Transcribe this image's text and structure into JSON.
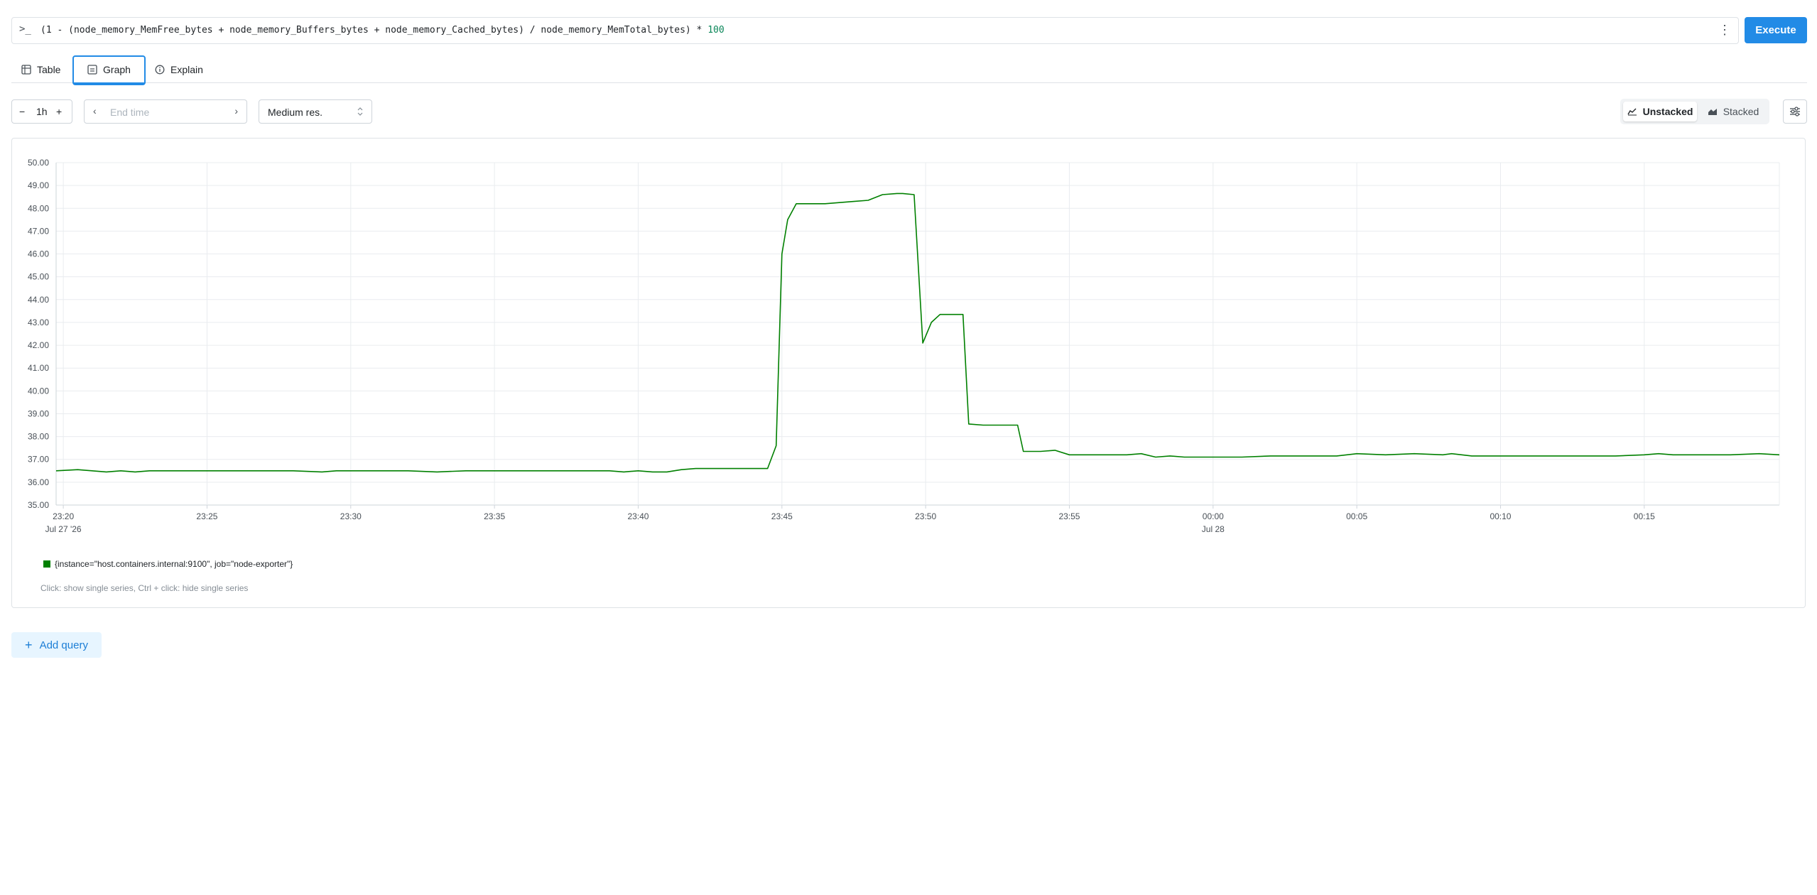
{
  "query": {
    "prompt_icon": "terminal-prompt-icon",
    "text_before_num": "(1 - (node_memory_MemFree_bytes + node_memory_Buffers_bytes + node_memory_Cached_bytes) / node_memory_MemTotal_bytes) * ",
    "text_num": "100",
    "more_icon": "vertical-dots-icon",
    "execute_label": "Execute"
  },
  "tabs": [
    {
      "label": "Table",
      "icon": "table-icon"
    },
    {
      "label": "Graph",
      "icon": "graph-icon",
      "active": true
    },
    {
      "label": "Explain",
      "icon": "info-icon"
    }
  ],
  "controls": {
    "range_value": "1h",
    "end_time_placeholder": "End time",
    "resolution_value": "Medium res.",
    "unstacked_label": "Unstacked",
    "stacked_label": "Stacked",
    "settings_icon": "sliders-icon"
  },
  "legend": {
    "series_label": "{instance=\"host.containers.internal:9100\", job=\"node-exporter\"}",
    "hint": "Click: show single series, Ctrl + click: hide single series"
  },
  "add_query_label": "Add query",
  "colors": {
    "accent": "#228be6",
    "series": "#008000"
  },
  "chart_data": {
    "type": "line",
    "y_ticks": [
      "35.00",
      "36.00",
      "37.00",
      "38.00",
      "39.00",
      "40.00",
      "41.00",
      "42.00",
      "43.00",
      "44.00",
      "45.00",
      "46.00",
      "47.00",
      "48.00",
      "49.00",
      "50.00"
    ],
    "ylim": [
      35,
      50
    ],
    "x_ticks": [
      {
        "label": "23:20",
        "sub": "Jul 27 '26",
        "t": 0
      },
      {
        "label": "23:25",
        "sub": "",
        "t": 5
      },
      {
        "label": "23:30",
        "sub": "",
        "t": 10
      },
      {
        "label": "23:35",
        "sub": "",
        "t": 15
      },
      {
        "label": "23:40",
        "sub": "",
        "t": 20
      },
      {
        "label": "23:45",
        "sub": "",
        "t": 25
      },
      {
        "label": "23:50",
        "sub": "",
        "t": 30
      },
      {
        "label": "23:55",
        "sub": "",
        "t": 35
      },
      {
        "label": "00:00",
        "sub": "Jul 28",
        "t": 40
      },
      {
        "label": "00:05",
        "sub": "",
        "t": 45
      },
      {
        "label": "00:10",
        "sub": "",
        "t": 50
      },
      {
        "label": "00:15",
        "sub": "",
        "t": 55
      }
    ],
    "xlim_minutes": [
      -0.25,
      59.7
    ],
    "grid": true,
    "series": [
      {
        "name": "{instance=\"host.containers.internal:9100\", job=\"node-exporter\"}",
        "x": [
          -0.25,
          0.5,
          1,
          1.5,
          2,
          2.5,
          3,
          3.5,
          4,
          5,
          6,
          7,
          8,
          9,
          9.5,
          10,
          10.5,
          11,
          12,
          13,
          14,
          15,
          16,
          17,
          18,
          19,
          19.5,
          20,
          20.5,
          21,
          21.5,
          22,
          22.5,
          23,
          23.5,
          24,
          24.5,
          24.8,
          25,
          25.2,
          25.5,
          26,
          26.5,
          27,
          27.5,
          28,
          28.5,
          29,
          29.2,
          29.6,
          29.9,
          30.2,
          30.5,
          30.9,
          31,
          31.3,
          31.5,
          32,
          32.5,
          33,
          33.2,
          33.4,
          34,
          34.5,
          35,
          36,
          37,
          37.5,
          38,
          38.5,
          39,
          40,
          41,
          42,
          43,
          44,
          44.3,
          45,
          46,
          47,
          48,
          48.3,
          49,
          50,
          51,
          52,
          53,
          54,
          55,
          55.5,
          56,
          57,
          58,
          59,
          59.7
        ],
        "values": [
          36.5,
          36.55,
          36.5,
          36.45,
          36.5,
          36.45,
          36.5,
          36.5,
          36.5,
          36.5,
          36.5,
          36.5,
          36.5,
          36.45,
          36.5,
          36.5,
          36.5,
          36.5,
          36.5,
          36.45,
          36.5,
          36.5,
          36.5,
          36.5,
          36.5,
          36.5,
          36.45,
          36.5,
          36.45,
          36.45,
          36.55,
          36.6,
          36.6,
          36.6,
          36.6,
          36.6,
          36.6,
          37.6,
          46.0,
          47.5,
          48.2,
          48.2,
          48.2,
          48.25,
          48.3,
          48.35,
          48.6,
          48.65,
          48.65,
          48.6,
          42.1,
          43.0,
          43.35,
          43.35,
          43.35,
          43.35,
          38.55,
          38.5,
          38.5,
          38.5,
          38.5,
          37.35,
          37.35,
          37.4,
          37.2,
          37.2,
          37.2,
          37.25,
          37.1,
          37.15,
          37.1,
          37.1,
          37.1,
          37.15,
          37.15,
          37.15,
          37.15,
          37.25,
          37.2,
          37.25,
          37.2,
          37.25,
          37.15,
          37.15,
          37.15,
          37.15,
          37.15,
          37.15,
          37.2,
          37.25,
          37.2,
          37.2,
          37.2,
          37.25,
          37.2
        ]
      }
    ]
  }
}
